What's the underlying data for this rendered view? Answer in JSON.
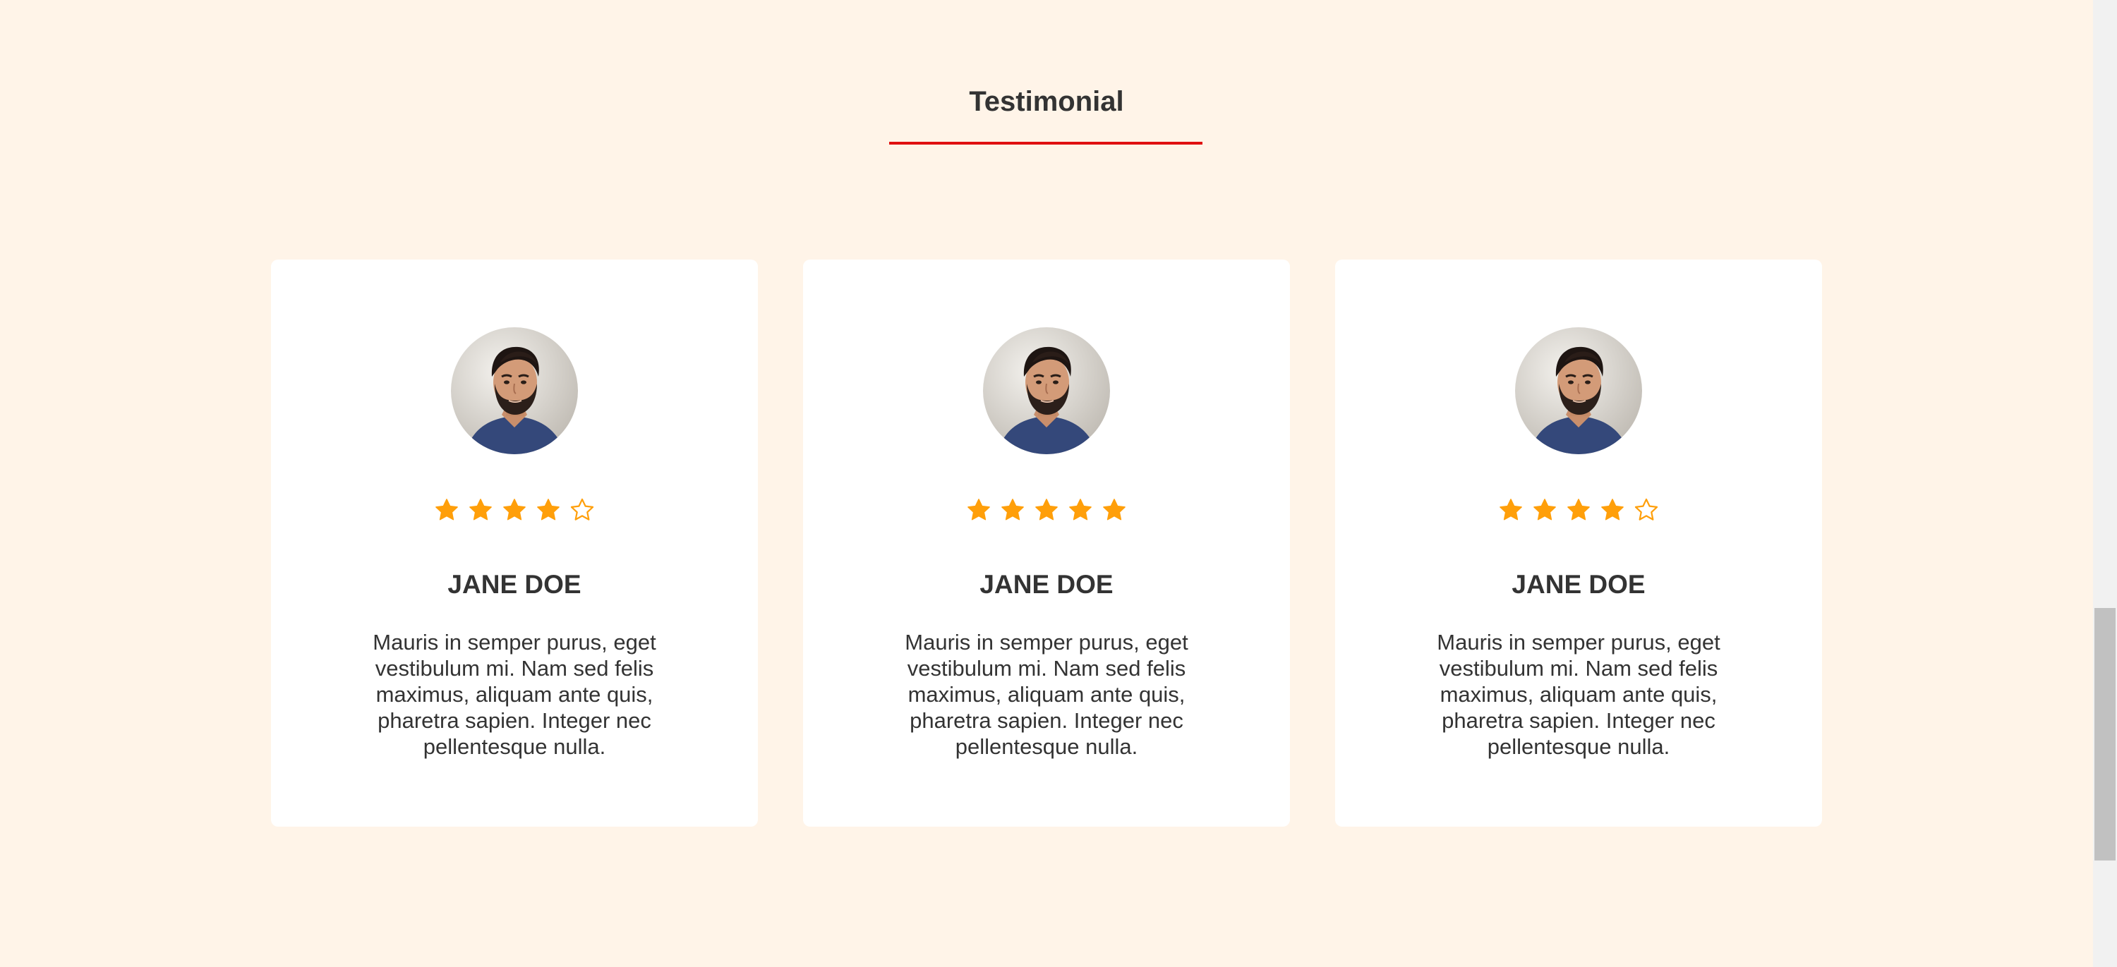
{
  "section": {
    "title": "Testimonial"
  },
  "colors": {
    "background": "#fff4e8",
    "accent_underline": "#e01010",
    "star": "#ff9f0a",
    "text": "#333333"
  },
  "testimonials": [
    {
      "avatar": "man-portrait-photo",
      "rating": 4,
      "max_rating": 5,
      "name": "JANE DOE",
      "quote": "Mauris in semper purus, eget vestibulum mi. Nam sed felis maximus, aliquam ante quis, pharetra sapien. Integer nec pellentesque nulla."
    },
    {
      "avatar": "man-portrait-photo",
      "rating": 5,
      "max_rating": 5,
      "name": "JANE DOE",
      "quote": "Mauris in semper purus, eget vestibulum mi. Nam sed felis maximus, aliquam ante quis, pharetra sapien. Integer nec pellentesque nulla."
    },
    {
      "avatar": "man-portrait-photo",
      "rating": 4,
      "max_rating": 5,
      "name": "JANE DOE",
      "quote": "Mauris in semper purus, eget vestibulum mi. Nam sed felis maximus, aliquam ante quis, pharetra sapien. Integer nec pellentesque nulla."
    }
  ]
}
